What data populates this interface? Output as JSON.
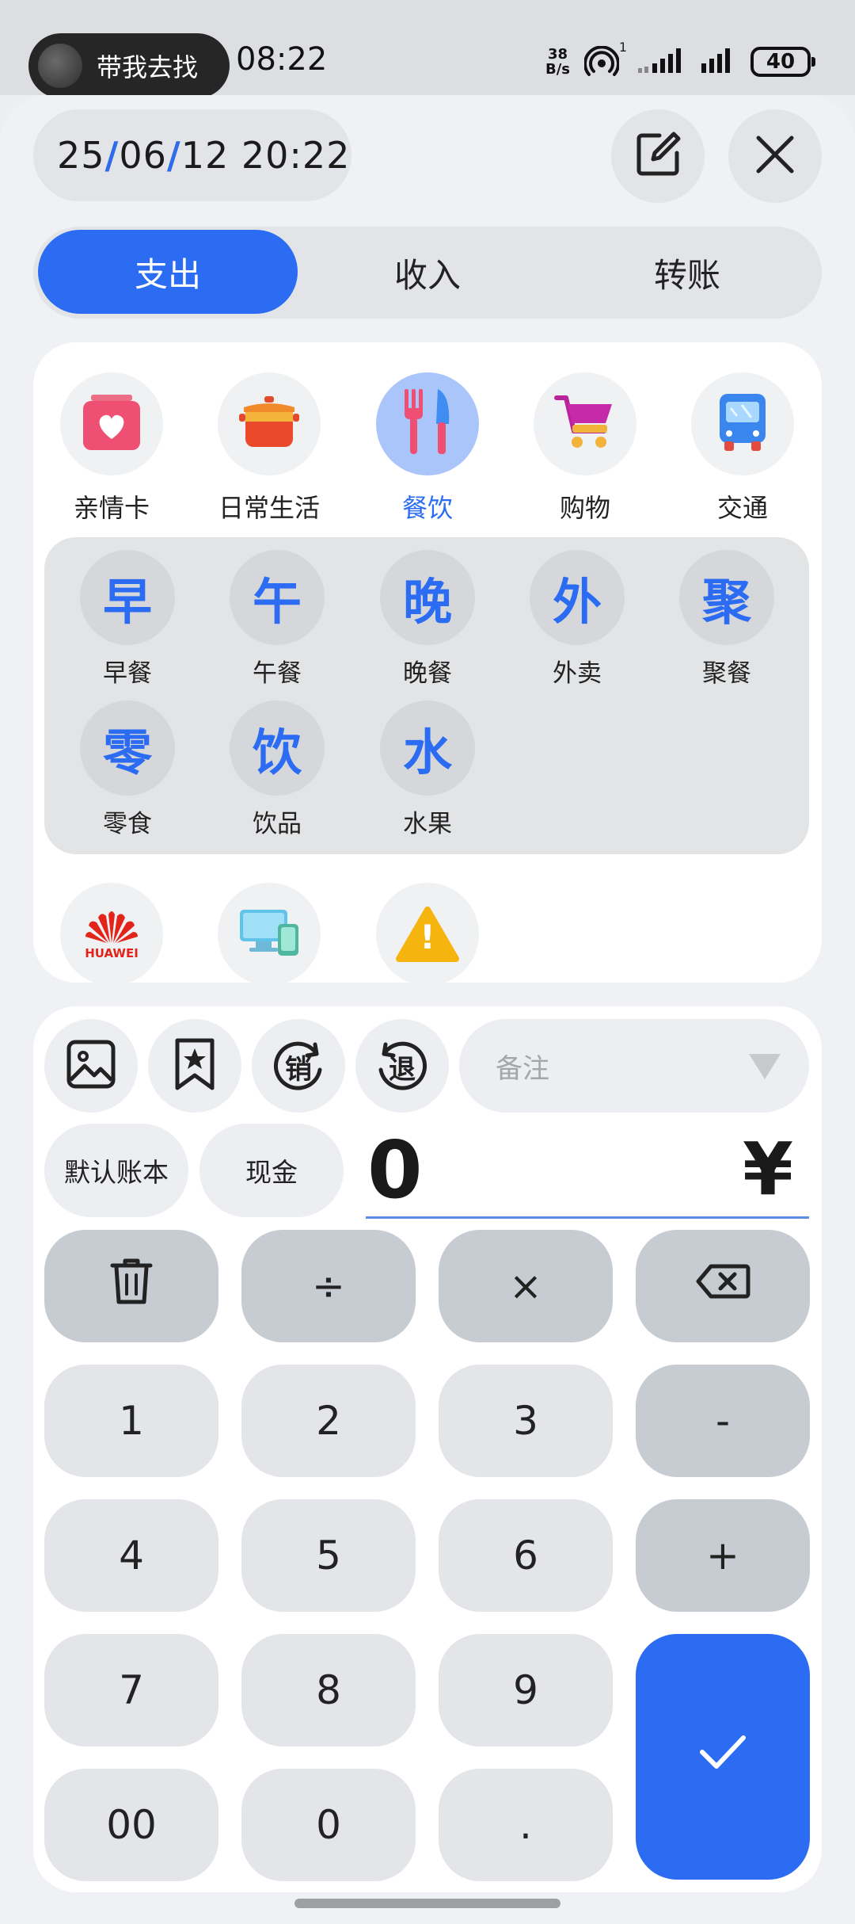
{
  "status_bar": {
    "notification": "带我去找",
    "time": "08:22",
    "net_speed_value": "38",
    "net_speed_unit": "B/s",
    "hotspot_badge": "1",
    "battery": "40"
  },
  "header": {
    "date_parts": [
      "25",
      "06",
      "12 20:22"
    ]
  },
  "tabs": [
    {
      "label": "支出",
      "active": true
    },
    {
      "label": "收入",
      "active": false
    },
    {
      "label": "转账",
      "active": false
    }
  ],
  "categories": [
    {
      "label": "亲情卡",
      "icon": "heart-card-icon",
      "selected": false
    },
    {
      "label": "日常生活",
      "icon": "cooking-pot-icon",
      "selected": false
    },
    {
      "label": "餐饮",
      "icon": "fork-knife-icon",
      "selected": true
    },
    {
      "label": "购物",
      "icon": "shopping-cart-icon",
      "selected": false
    },
    {
      "label": "交通",
      "icon": "bus-icon",
      "selected": false
    }
  ],
  "subcategories": [
    {
      "glyph": "早",
      "label": "早餐"
    },
    {
      "glyph": "午",
      "label": "午餐"
    },
    {
      "glyph": "晚",
      "label": "晚餐"
    },
    {
      "glyph": "外",
      "label": "外卖"
    },
    {
      "glyph": "聚",
      "label": "聚餐"
    },
    {
      "glyph": "零",
      "label": "零食"
    },
    {
      "glyph": "饮",
      "label": "饮品"
    },
    {
      "glyph": "水",
      "label": "水果"
    }
  ],
  "more_categories": [
    {
      "icon": "huawei-logo-icon",
      "brand_text": "HUAWEI"
    },
    {
      "icon": "devices-icon"
    },
    {
      "icon": "warning-icon",
      "glyph": "!"
    }
  ],
  "tools": {
    "sale_glyph": "销",
    "refund_glyph": "退",
    "note_placeholder": "备注",
    "account_book": "默认账本",
    "account": "现金"
  },
  "amount": {
    "value": "0",
    "currency": "¥"
  },
  "keypad": {
    "divide": "÷",
    "multiply": "×",
    "minus": "-",
    "plus": "+",
    "digits": [
      "1",
      "2",
      "3",
      "4",
      "5",
      "6",
      "7",
      "8",
      "9",
      "00",
      "0",
      "."
    ]
  },
  "colors": {
    "accent": "#2c6cf3",
    "selected_category_bg": "#a9c5fa"
  }
}
